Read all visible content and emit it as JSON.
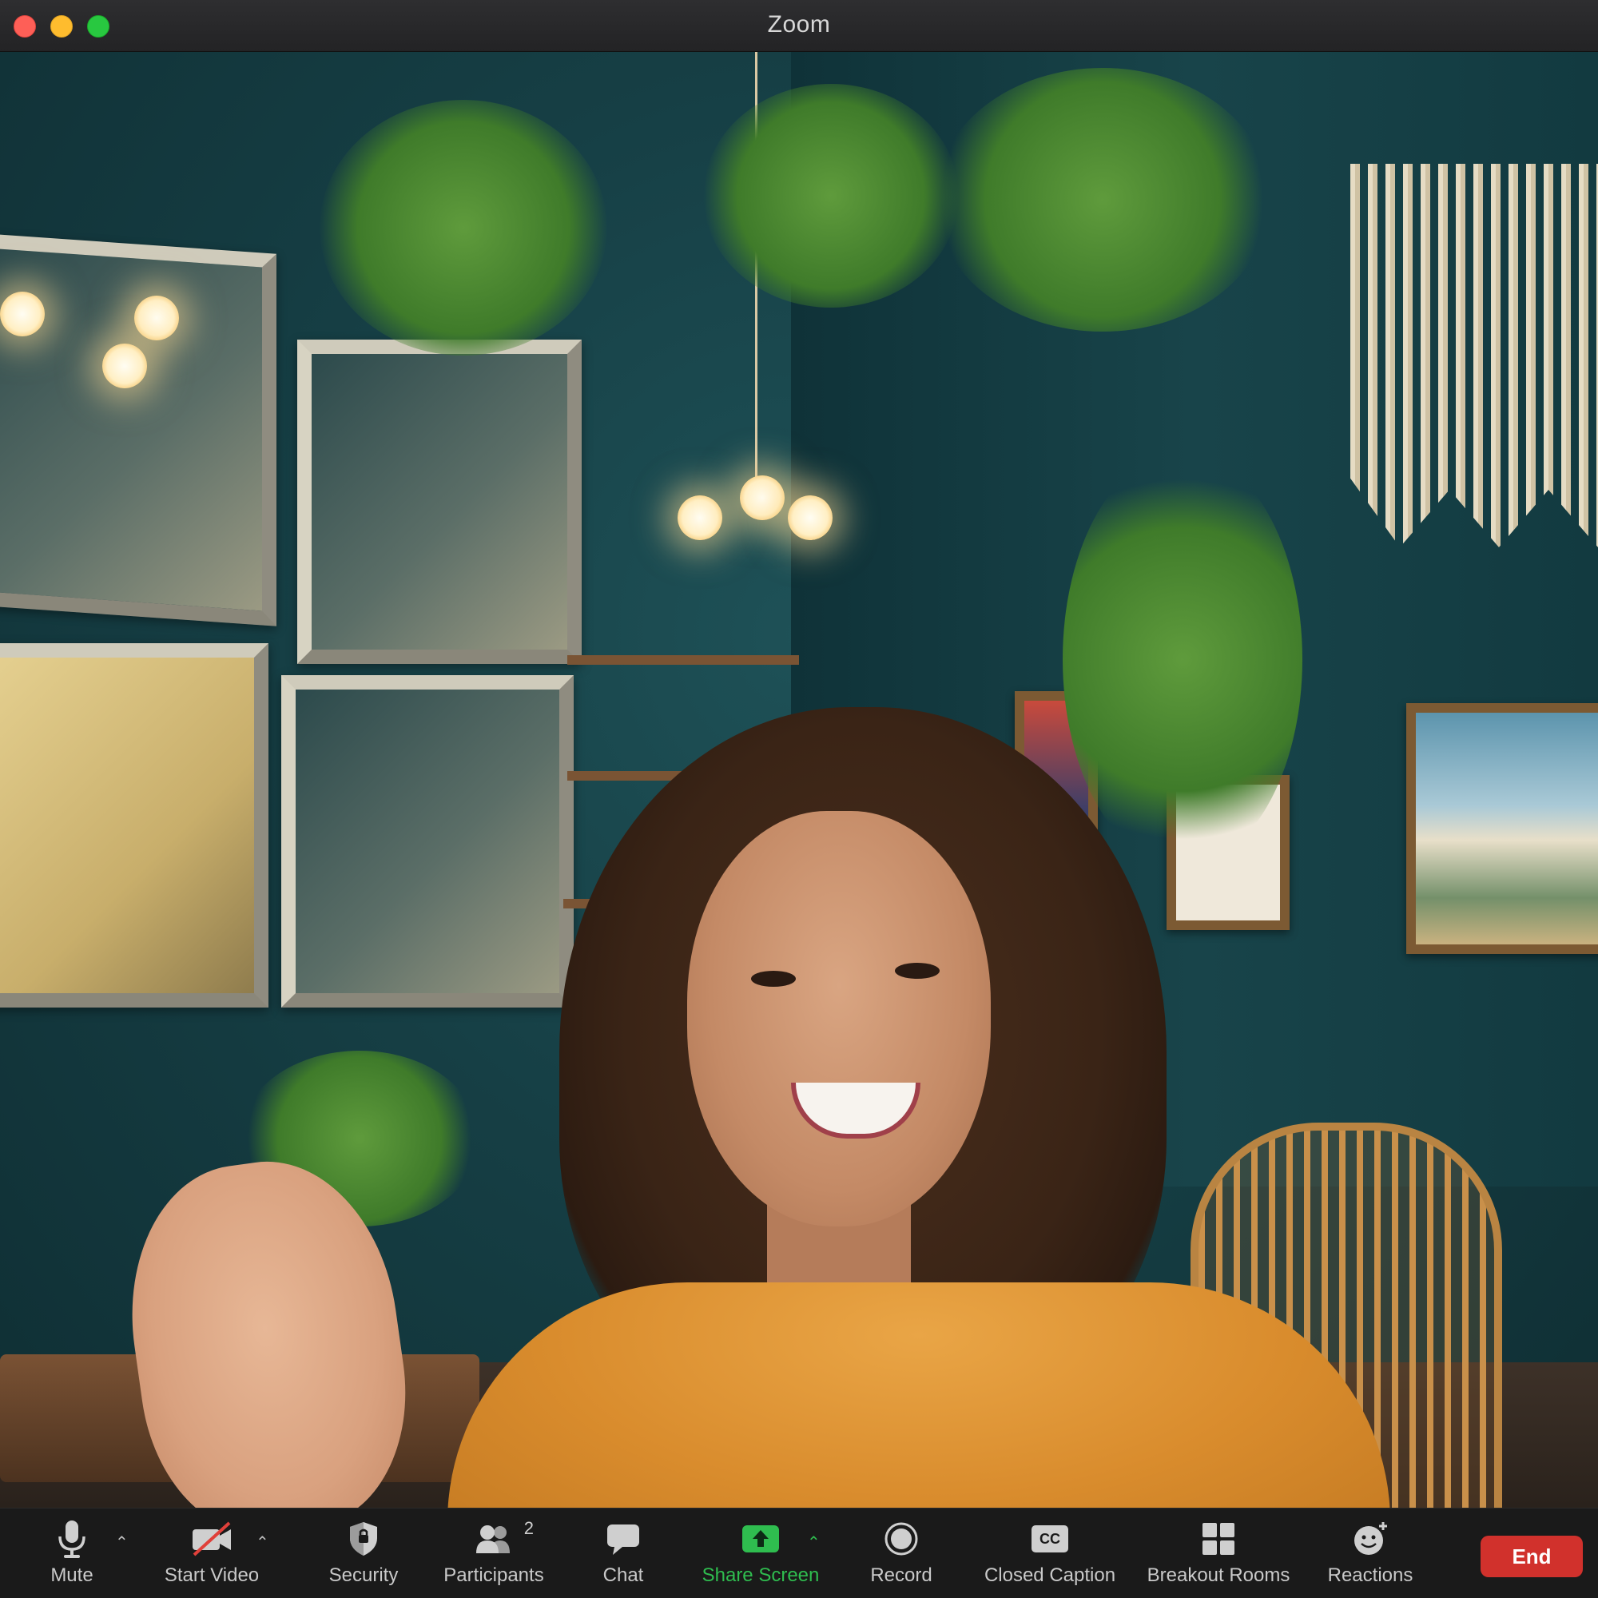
{
  "window": {
    "title": "Zoom"
  },
  "toolbar": {
    "mute_label": "Mute",
    "start_video_label": "Start Video",
    "security_label": "Security",
    "participants_label": "Participants",
    "participants_count": "2",
    "chat_label": "Chat",
    "share_screen_label": "Share Screen",
    "record_label": "Record",
    "closed_caption_label": "Closed Caption",
    "closed_caption_icon_text": "CC",
    "breakout_rooms_label": "Breakout Rooms",
    "reactions_label": "Reactions",
    "end_label": "End"
  },
  "icons": {
    "mute": "microphone-icon",
    "start_video": "video-off-icon",
    "security": "shield-icon",
    "participants": "people-icon",
    "chat": "chat-bubble-icon",
    "share_screen": "share-up-arrow-icon",
    "record": "record-circle-icon",
    "closed_caption": "cc-icon",
    "breakout_rooms": "grid-icon",
    "reactions": "smiley-plus-icon"
  },
  "colors": {
    "share_screen": "#2fbd4f",
    "end_button": "#d1312c",
    "toolbar_bg": "#1a1a1a"
  }
}
